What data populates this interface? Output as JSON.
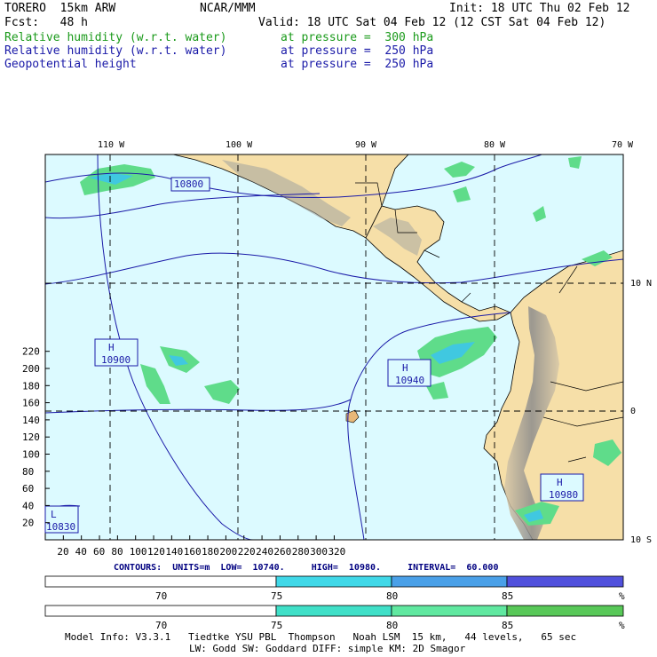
{
  "header": {
    "model": "TORERO  15km ARW",
    "center": "NCAR/MMM",
    "init": "Init: 18 UTC Thu 02 Feb 12",
    "fcst": "Fcst:   48 h",
    "valid": "Valid: 18 UTC Sat 04 Feb 12 (12 CST Sat 04 Feb 12)",
    "fields": [
      {
        "name": "Relative humidity (w.r.t. water)",
        "level": "at pressure =  300 hPa",
        "color": "#1a9a1a"
      },
      {
        "name": "Relative humidity (w.r.t. water)",
        "level": "at pressure =  250 hPa",
        "color": "#1a1aa8"
      },
      {
        "name": "Geopotential height",
        "level": "at pressure =  250 hPa",
        "color": "#1a1aa8"
      }
    ]
  },
  "map": {
    "lon_labels": [
      "110 W",
      "100 W",
      "90 W",
      "80 W",
      "70 W"
    ],
    "lat_labels": [
      "10 N",
      "0",
      "10 S"
    ],
    "x_ticks": [
      "20",
      "40",
      "60",
      "80",
      "100",
      "120",
      "140",
      "160",
      "180",
      "200",
      "220",
      "240",
      "260",
      "280",
      "300",
      "320"
    ],
    "y_ticks": [
      "20",
      "40",
      "60",
      "80",
      "100",
      "120",
      "140",
      "160",
      "180",
      "200",
      "220"
    ],
    "contour_labels": [
      "10800",
      "10900",
      "10940",
      "10980",
      "10830"
    ],
    "highs": [
      {
        "letter": "H",
        "value": "10900"
      },
      {
        "letter": "H",
        "value": "10940"
      },
      {
        "letter": "H",
        "value": "10980"
      }
    ],
    "lows": [
      {
        "letter": "L",
        "value": "10830"
      }
    ],
    "colors": {
      "ocean": "#dcfaff",
      "land": "#f6dfa8",
      "terrain_dark": "#8a8a8a",
      "rh_green": "#5fdc8a",
      "rh_cyan": "#36c9e8",
      "contour": "#1a1aa8"
    }
  },
  "contour_info": "CONTOURS:  UNITS=m  LOW=  10740.     HIGH=  10980.     INTERVAL=  60.000",
  "colorbar1": {
    "ticks": [
      "70",
      "75",
      "80",
      "85"
    ],
    "unit": "%",
    "colors": [
      "#ffffff",
      "#40d8e8",
      "#4aa0e8",
      "#5050dc"
    ]
  },
  "colorbar2": {
    "ticks": [
      "70",
      "75",
      "80",
      "85"
    ],
    "unit": "%",
    "colors": [
      "#ffffff",
      "#40e0c8",
      "#60e8a0",
      "#58c858"
    ]
  },
  "footer": {
    "line1": "Model Info: V3.3.1   Tiedtke YSU PBL  Thompson   Noah LSM  15 km,   44 levels,   65 sec",
    "line2": "LW: Godd SW: Goddard DIFF: simple KM: 2D Smagor"
  }
}
